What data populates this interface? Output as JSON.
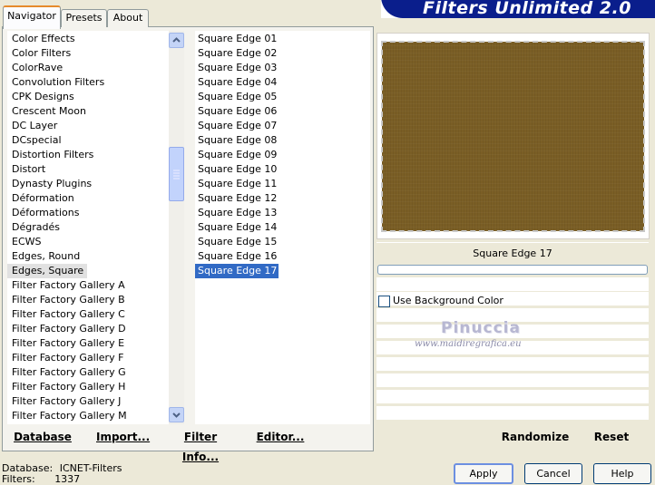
{
  "tabs": [
    {
      "label": "Navigator",
      "active": true
    },
    {
      "label": "Presets",
      "active": false
    },
    {
      "label": "About",
      "active": false
    }
  ],
  "title": "Filters Unlimited 2.0",
  "categories": [
    "Color Effects",
    "Color Filters",
    "ColorRave",
    "Convolution Filters",
    "CPK Designs",
    "Crescent Moon",
    "DC Layer",
    "DCspecial",
    "Distortion Filters",
    "Distort",
    "Dynasty Plugins",
    "Déformation",
    "Déformations",
    "Dégradés",
    "ECWS",
    "Edges, Round",
    "Edges, Square",
    "Filter Factory Gallery A",
    "Filter Factory Gallery B",
    "Filter Factory Gallery C",
    "Filter Factory Gallery D",
    "Filter Factory Gallery E",
    "Filter Factory Gallery F",
    "Filter Factory Gallery G",
    "Filter Factory Gallery H",
    "Filter Factory Gallery J",
    "Filter Factory Gallery M"
  ],
  "selected_category": "Edges, Square",
  "filters": [
    "Square Edge 01",
    "Square Edge 02",
    "Square Edge 03",
    "Square Edge 04",
    "Square Edge 05",
    "Square Edge 06",
    "Square Edge 07",
    "Square Edge 08",
    "Square Edge 09",
    "Square Edge 10",
    "Square Edge 11",
    "Square Edge 12",
    "Square Edge 13",
    "Square Edge 14",
    "Square Edge 15",
    "Square Edge 16",
    "Square Edge 17"
  ],
  "selected_filter": "Square Edge 17",
  "left_buttons": {
    "database": "Database",
    "import": "Import...",
    "filter_info": "Filter Info...",
    "editor": "Editor..."
  },
  "preview": {
    "filter_name": "Square Edge 17",
    "color": "#7a5e25",
    "progress_percent": 0
  },
  "options": {
    "use_background_color": {
      "label": "Use Background Color",
      "checked": false
    }
  },
  "watermark": {
    "name": "Pinuccia",
    "url": "www.maidiregrafica.eu"
  },
  "right_buttons": {
    "randomize": "Randomize",
    "reset": "Reset"
  },
  "footer": {
    "database_label": "Database:",
    "database_value": "ICNET-Filters",
    "filters_label": "Filters:",
    "filters_value": "1337"
  },
  "dialog_buttons": {
    "apply": "Apply",
    "cancel": "Cancel",
    "help": "Help"
  },
  "colors": {
    "title_bg": "#0a1e8c",
    "selection": "#316ac5",
    "accent_tab": "#e68b2c"
  }
}
